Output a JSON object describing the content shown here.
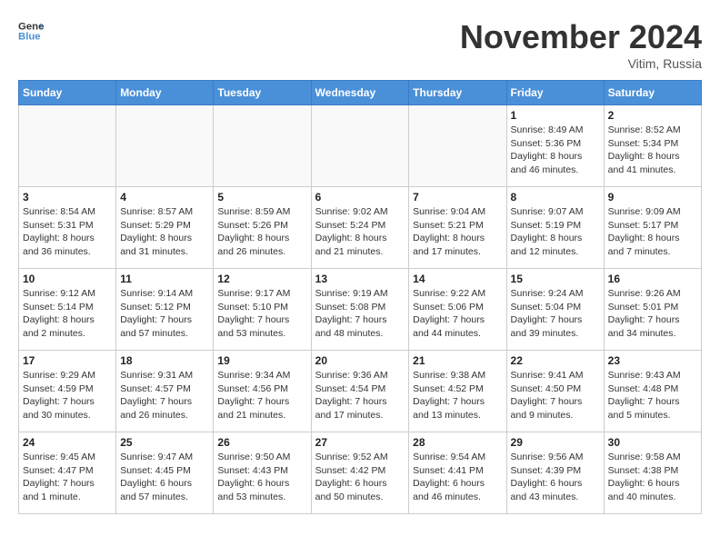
{
  "header": {
    "logo_general": "General",
    "logo_blue": "Blue",
    "month_title": "November 2024",
    "location": "Vitim, Russia"
  },
  "days_of_week": [
    "Sunday",
    "Monday",
    "Tuesday",
    "Wednesday",
    "Thursday",
    "Friday",
    "Saturday"
  ],
  "weeks": [
    [
      {
        "day": "",
        "info": ""
      },
      {
        "day": "",
        "info": ""
      },
      {
        "day": "",
        "info": ""
      },
      {
        "day": "",
        "info": ""
      },
      {
        "day": "",
        "info": ""
      },
      {
        "day": "1",
        "info": "Sunrise: 8:49 AM\nSunset: 5:36 PM\nDaylight: 8 hours and 46 minutes."
      },
      {
        "day": "2",
        "info": "Sunrise: 8:52 AM\nSunset: 5:34 PM\nDaylight: 8 hours and 41 minutes."
      }
    ],
    [
      {
        "day": "3",
        "info": "Sunrise: 8:54 AM\nSunset: 5:31 PM\nDaylight: 8 hours and 36 minutes."
      },
      {
        "day": "4",
        "info": "Sunrise: 8:57 AM\nSunset: 5:29 PM\nDaylight: 8 hours and 31 minutes."
      },
      {
        "day": "5",
        "info": "Sunrise: 8:59 AM\nSunset: 5:26 PM\nDaylight: 8 hours and 26 minutes."
      },
      {
        "day": "6",
        "info": "Sunrise: 9:02 AM\nSunset: 5:24 PM\nDaylight: 8 hours and 21 minutes."
      },
      {
        "day": "7",
        "info": "Sunrise: 9:04 AM\nSunset: 5:21 PM\nDaylight: 8 hours and 17 minutes."
      },
      {
        "day": "8",
        "info": "Sunrise: 9:07 AM\nSunset: 5:19 PM\nDaylight: 8 hours and 12 minutes."
      },
      {
        "day": "9",
        "info": "Sunrise: 9:09 AM\nSunset: 5:17 PM\nDaylight: 8 hours and 7 minutes."
      }
    ],
    [
      {
        "day": "10",
        "info": "Sunrise: 9:12 AM\nSunset: 5:14 PM\nDaylight: 8 hours and 2 minutes."
      },
      {
        "day": "11",
        "info": "Sunrise: 9:14 AM\nSunset: 5:12 PM\nDaylight: 7 hours and 57 minutes."
      },
      {
        "day": "12",
        "info": "Sunrise: 9:17 AM\nSunset: 5:10 PM\nDaylight: 7 hours and 53 minutes."
      },
      {
        "day": "13",
        "info": "Sunrise: 9:19 AM\nSunset: 5:08 PM\nDaylight: 7 hours and 48 minutes."
      },
      {
        "day": "14",
        "info": "Sunrise: 9:22 AM\nSunset: 5:06 PM\nDaylight: 7 hours and 44 minutes."
      },
      {
        "day": "15",
        "info": "Sunrise: 9:24 AM\nSunset: 5:04 PM\nDaylight: 7 hours and 39 minutes."
      },
      {
        "day": "16",
        "info": "Sunrise: 9:26 AM\nSunset: 5:01 PM\nDaylight: 7 hours and 34 minutes."
      }
    ],
    [
      {
        "day": "17",
        "info": "Sunrise: 9:29 AM\nSunset: 4:59 PM\nDaylight: 7 hours and 30 minutes."
      },
      {
        "day": "18",
        "info": "Sunrise: 9:31 AM\nSunset: 4:57 PM\nDaylight: 7 hours and 26 minutes."
      },
      {
        "day": "19",
        "info": "Sunrise: 9:34 AM\nSunset: 4:56 PM\nDaylight: 7 hours and 21 minutes."
      },
      {
        "day": "20",
        "info": "Sunrise: 9:36 AM\nSunset: 4:54 PM\nDaylight: 7 hours and 17 minutes."
      },
      {
        "day": "21",
        "info": "Sunrise: 9:38 AM\nSunset: 4:52 PM\nDaylight: 7 hours and 13 minutes."
      },
      {
        "day": "22",
        "info": "Sunrise: 9:41 AM\nSunset: 4:50 PM\nDaylight: 7 hours and 9 minutes."
      },
      {
        "day": "23",
        "info": "Sunrise: 9:43 AM\nSunset: 4:48 PM\nDaylight: 7 hours and 5 minutes."
      }
    ],
    [
      {
        "day": "24",
        "info": "Sunrise: 9:45 AM\nSunset: 4:47 PM\nDaylight: 7 hours and 1 minute."
      },
      {
        "day": "25",
        "info": "Sunrise: 9:47 AM\nSunset: 4:45 PM\nDaylight: 6 hours and 57 minutes."
      },
      {
        "day": "26",
        "info": "Sunrise: 9:50 AM\nSunset: 4:43 PM\nDaylight: 6 hours and 53 minutes."
      },
      {
        "day": "27",
        "info": "Sunrise: 9:52 AM\nSunset: 4:42 PM\nDaylight: 6 hours and 50 minutes."
      },
      {
        "day": "28",
        "info": "Sunrise: 9:54 AM\nSunset: 4:41 PM\nDaylight: 6 hours and 46 minutes."
      },
      {
        "day": "29",
        "info": "Sunrise: 9:56 AM\nSunset: 4:39 PM\nDaylight: 6 hours and 43 minutes."
      },
      {
        "day": "30",
        "info": "Sunrise: 9:58 AM\nSunset: 4:38 PM\nDaylight: 6 hours and 40 minutes."
      }
    ]
  ]
}
